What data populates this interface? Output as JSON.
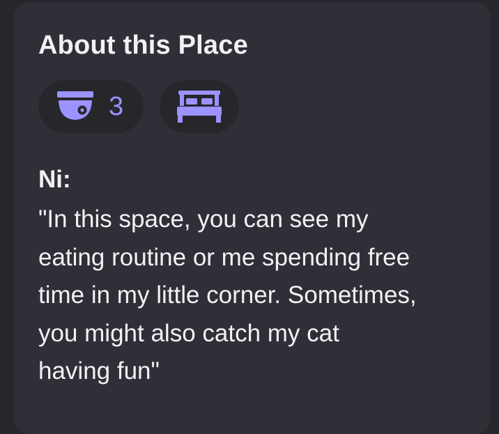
{
  "section": {
    "title": "About this Place"
  },
  "features": [
    {
      "icon": "security-camera-icon",
      "count": "3"
    },
    {
      "icon": "bed-icon"
    }
  ],
  "accent_color": "#9b93ff",
  "description": {
    "author": "Ni:",
    "lines": [
      "\"In this space, you can see my",
      "eating routine or me spending free",
      "time in my little corner. Sometimes,",
      "you might also catch my cat",
      "having fun\""
    ]
  }
}
